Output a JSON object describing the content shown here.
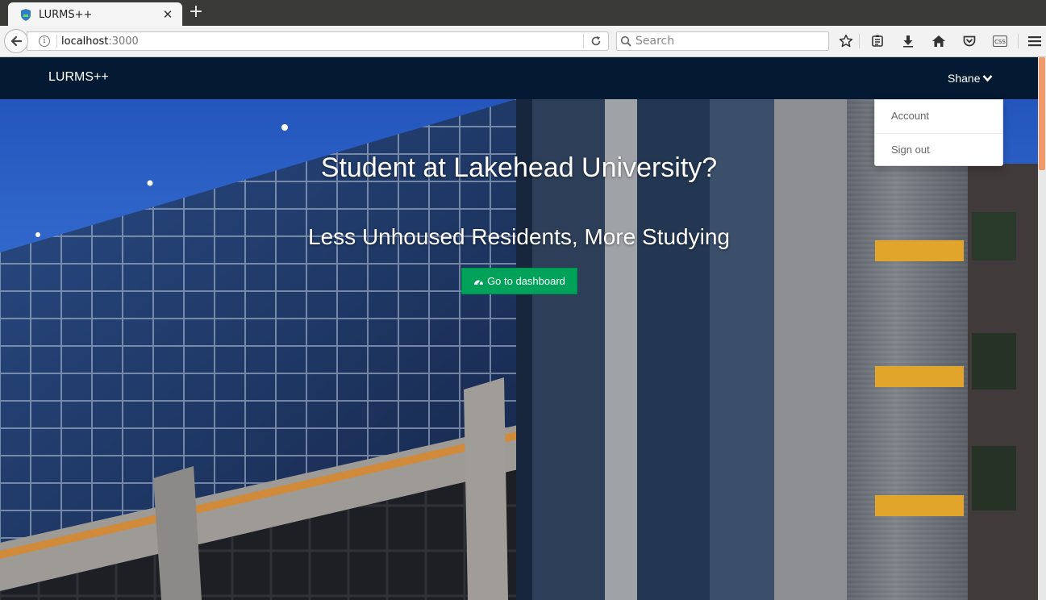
{
  "browser": {
    "tab_title": "LURMS++",
    "url_host": "localhost",
    "url_port": ":3000",
    "search_placeholder": "Search"
  },
  "site": {
    "brand": "LURMS++",
    "user_name": "Shane",
    "dropdown": [
      "Account",
      "Sign out"
    ]
  },
  "hero": {
    "title": "Student at Lakehead University?",
    "subtitle": "Less Unhoused Residents, More Studying",
    "cta_label": "Go to dashboard"
  },
  "colors": {
    "navbar": "#031a32",
    "cta": "#00a25a",
    "scroll_thumb": "#ee9a6b"
  },
  "icons": [
    "back-arrow-icon",
    "info-icon",
    "reload-icon",
    "search-icon",
    "bookmark-star-icon",
    "reading-list-icon",
    "download-icon",
    "home-icon",
    "pocket-icon",
    "css-icon",
    "hamburger-menu-icon",
    "chevron-down-icon",
    "dashboard-icon"
  ]
}
